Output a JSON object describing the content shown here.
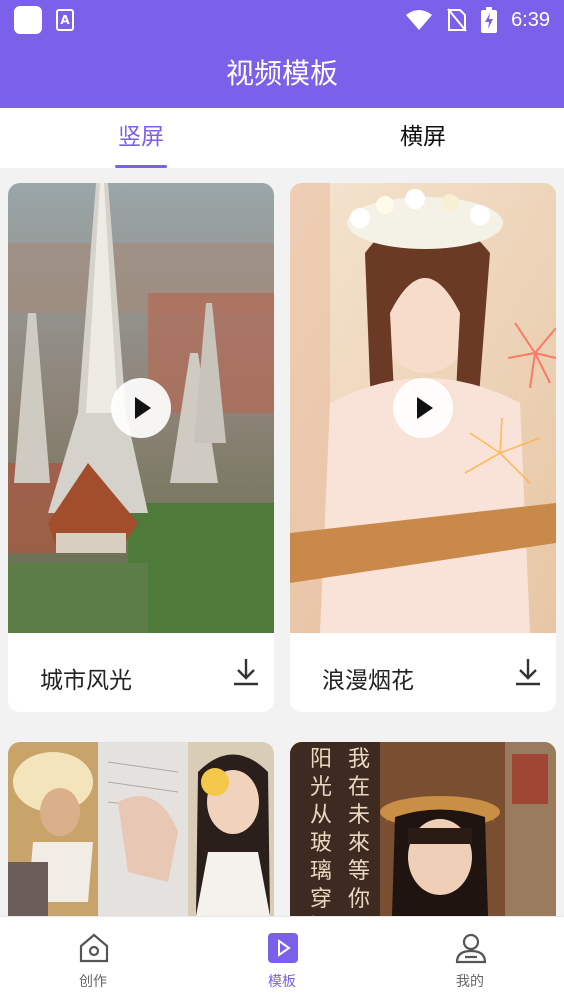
{
  "status_bar": {
    "time": "6:39",
    "left_icons": [
      "app-square-icon",
      "a-keyboard-icon"
    ],
    "right_icons": [
      "wifi-icon",
      "no-sim-icon",
      "battery-charging-icon"
    ]
  },
  "app_bar": {
    "title": "视频模板"
  },
  "tabs": [
    {
      "label": "竖屏",
      "active": true
    },
    {
      "label": "横屏",
      "active": false
    }
  ],
  "templates": [
    {
      "label": "城市风光",
      "image": "temple-city-aerial",
      "icon": "download-icon"
    },
    {
      "label": "浪漫烟花",
      "image": "girl-flower-crown-fireworks",
      "icon": "download-icon"
    },
    {
      "label": "",
      "image": "collage-girl-sunset-lemon"
    },
    {
      "label": "",
      "image": "girl-straw-hat-calligraphy",
      "overlay_text": [
        "阳光从玻璃穿過",
        "我在未來等你"
      ]
    }
  ],
  "bottom_nav": [
    {
      "label": "创作",
      "icon": "home-icon",
      "active": false
    },
    {
      "label": "模板",
      "icon": "play-square-icon",
      "active": true
    },
    {
      "label": "我的",
      "icon": "user-icon",
      "active": false
    }
  ],
  "colors": {
    "accent": "#7b61ea",
    "background": "#f2f2f2"
  }
}
